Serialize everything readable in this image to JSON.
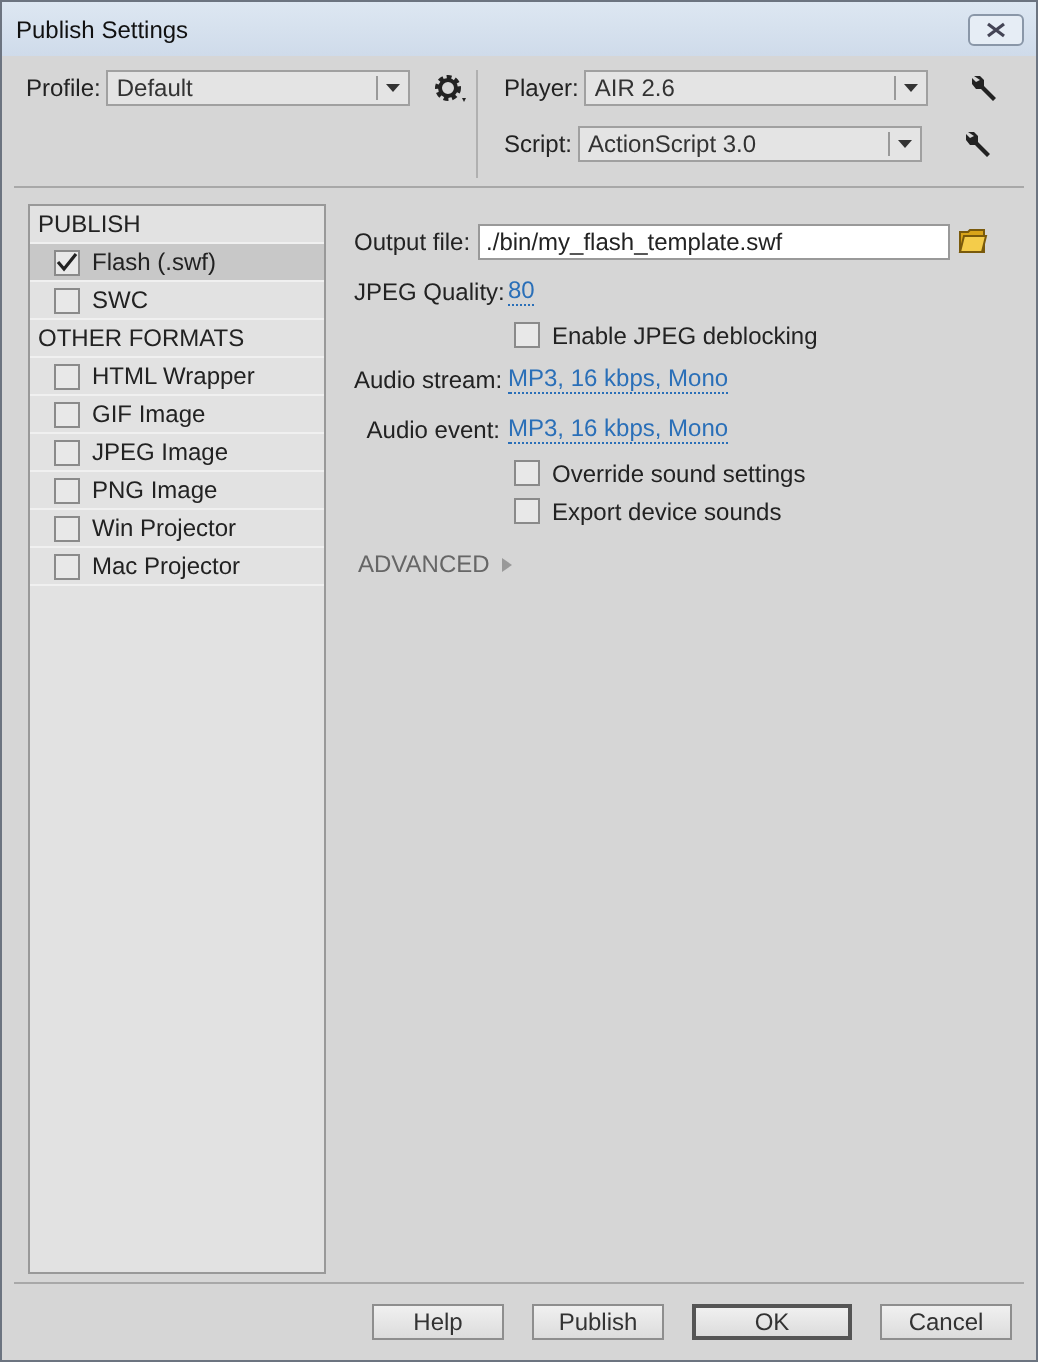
{
  "window": {
    "title": "Publish Settings"
  },
  "profile": {
    "label": "Profile:",
    "value": "Default"
  },
  "player": {
    "label": "Player:",
    "value": "AIR 2.6"
  },
  "script": {
    "label": "Script:",
    "value": "ActionScript 3.0"
  },
  "sidebar": [
    {
      "kind": "header",
      "label": "PUBLISH"
    },
    {
      "kind": "item",
      "label": "Flash (.swf)",
      "checked": true,
      "selected": true
    },
    {
      "kind": "item",
      "label": "SWC",
      "checked": false,
      "selected": false
    },
    {
      "kind": "header",
      "label": "OTHER FORMATS"
    },
    {
      "kind": "item",
      "label": "HTML Wrapper",
      "checked": false,
      "selected": false
    },
    {
      "kind": "item",
      "label": "GIF Image",
      "checked": false,
      "selected": false
    },
    {
      "kind": "item",
      "label": "JPEG Image",
      "checked": false,
      "selected": false
    },
    {
      "kind": "item",
      "label": "PNG Image",
      "checked": false,
      "selected": false
    },
    {
      "kind": "item",
      "label": "Win Projector",
      "checked": false,
      "selected": false
    },
    {
      "kind": "item",
      "label": "Mac Projector",
      "checked": false,
      "selected": false
    }
  ],
  "settings": [
    {
      "kind": "field",
      "label": "Output file:",
      "value": "./bin/my_flash_template.swf"
    },
    {
      "kind": "link",
      "label": "JPEG Quality:",
      "value": "80"
    },
    {
      "kind": "checkbox",
      "label": "Enable JPEG deblocking",
      "checked": false
    },
    {
      "kind": "link",
      "label": "Audio stream:",
      "value": "MP3, 16 kbps, Mono"
    },
    {
      "kind": "link",
      "label": "Audio event:",
      "value": "MP3, 16 kbps, Mono"
    },
    {
      "kind": "checkbox",
      "label": "Override sound settings",
      "checked": false
    },
    {
      "kind": "checkbox",
      "label": "Export device sounds",
      "checked": false
    }
  ],
  "advanced": {
    "label": "ADVANCED",
    "expanded": false
  },
  "buttons": [
    {
      "label": "Help",
      "default": false
    },
    {
      "label": "Publish",
      "default": false
    },
    {
      "label": "OK",
      "default": true
    },
    {
      "label": "Cancel",
      "default": false
    }
  ]
}
